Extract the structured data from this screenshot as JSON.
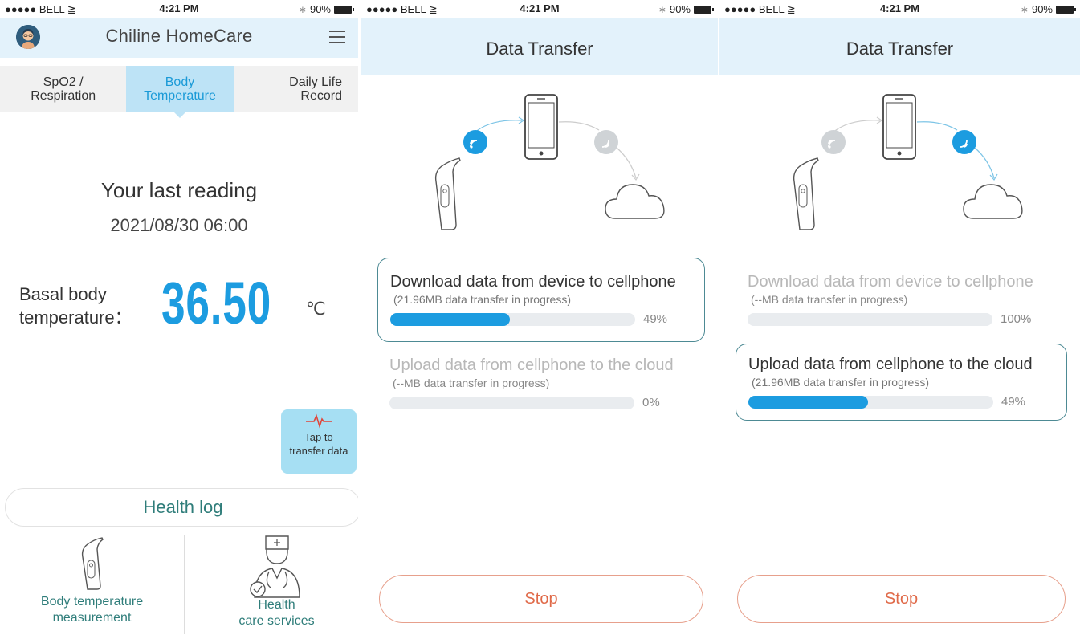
{
  "status_bar": {
    "carrier": "●●●●● BELL ≧",
    "time": "4:21 PM",
    "battery": "90%"
  },
  "screen1": {
    "app_title": "Chiline HomeCare",
    "tabs": [
      {
        "label": "SpO2 / Respiration"
      },
      {
        "label": "Body Temperature",
        "active": true
      },
      {
        "label": "Daily Life Record"
      }
    ],
    "last_reading_label": "Your last reading",
    "reading_datetime": "2021/08/30 06:00",
    "basal_label_line1": "Basal body",
    "basal_label_line2": "temperature：",
    "temperature": "36.50",
    "unit": "℃",
    "transfer_button": {
      "line1": "Tap to",
      "line2": "transfer data"
    },
    "health_log": "Health log",
    "bottom_items": [
      {
        "line1": "Body temperature",
        "line2": "measurement",
        "icon": "thermometer-icon"
      },
      {
        "line1": "Health",
        "line2": "care services",
        "icon": "doctor-icon"
      }
    ]
  },
  "screen2": {
    "title": "Data Transfer",
    "download": {
      "title": "Download data from device to cellphone",
      "sub": "(21.96MB data transfer in progress)",
      "progress": 0.49,
      "pct": "49%"
    },
    "upload": {
      "title": "Upload data from cellphone to the cloud",
      "sub": "(--MB data transfer in progress)",
      "progress": 0,
      "pct": "0%"
    },
    "stop": "Stop"
  },
  "screen3": {
    "title": "Data Transfer",
    "download": {
      "title": "Download data from device to cellphone",
      "sub": "(--MB data transfer in progress)",
      "progress": 1.0,
      "pct": "100%"
    },
    "upload": {
      "title": "Upload data from cellphone to the cloud",
      "sub": "(21.96MB data transfer in progress)",
      "progress": 0.49,
      "pct": "49%"
    },
    "stop": "Stop"
  },
  "colors": {
    "accent": "#1c9ce0",
    "header_bg": "#e3f2fb",
    "teal": "#2f7d7a",
    "stop": "#e06a49",
    "transfer_button": "#a6dff3"
  }
}
